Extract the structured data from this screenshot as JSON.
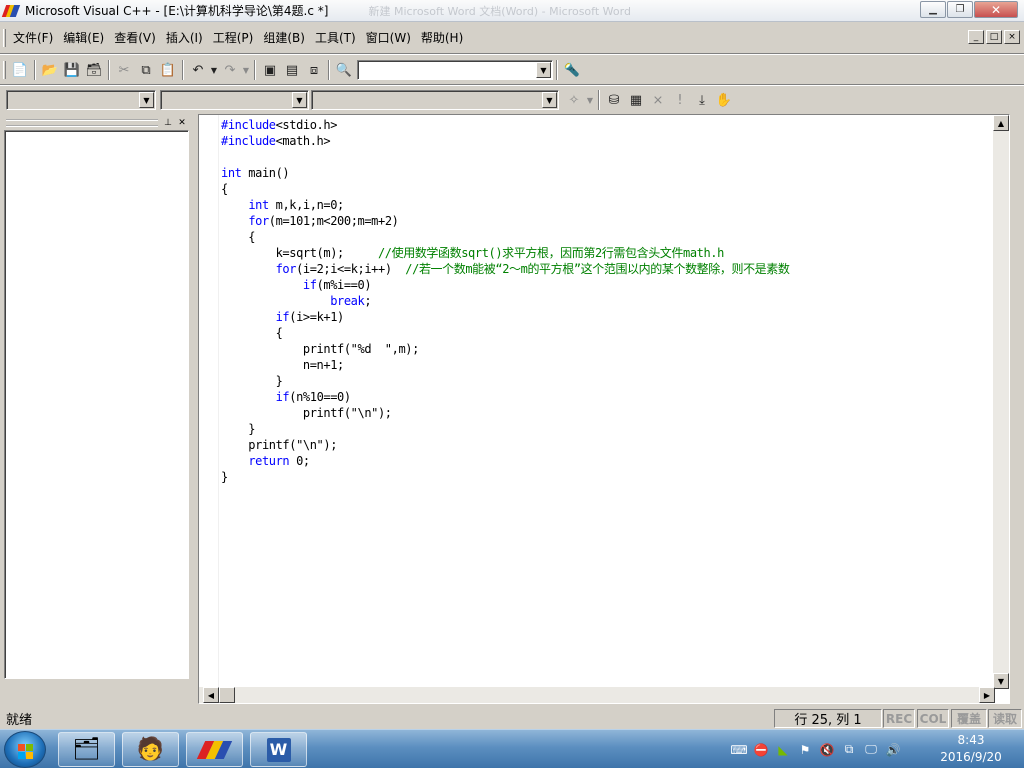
{
  "window": {
    "title": "Microsoft Visual C++ - [E:\\计算机科学导论\\第4题.c *]",
    "background_title": "新建 Microsoft Word 文档(Word) - Microsoft Word"
  },
  "menu": [
    "文件(F)",
    "编辑(E)",
    "查看(V)",
    "插入(I)",
    "工程(P)",
    "组建(B)",
    "工具(T)",
    "窗口(W)",
    "帮助(H)"
  ],
  "mdi_controls": [
    "_",
    "□",
    "×"
  ],
  "toolbar": {
    "icons": [
      "workspace-icon",
      "open-icon",
      "save-icon",
      "save-all-icon",
      "cut-icon",
      "copy-icon",
      "paste-icon",
      "undo-icon",
      "redo-icon",
      "workspace-window-icon",
      "output-window-icon",
      "window-list-icon",
      "find-in-files-icon",
      "find-icon"
    ],
    "find_value": ""
  },
  "wizardbar": {
    "class_value": "",
    "filter_value": "",
    "member_value": ""
  },
  "code": [
    [
      [
        "kw",
        "#include"
      ],
      [
        "t",
        "<stdio.h>"
      ]
    ],
    [
      [
        "kw",
        "#include"
      ],
      [
        "t",
        "<math.h>"
      ]
    ],
    [],
    [
      [
        "kw",
        "int"
      ],
      [
        "t",
        " main()"
      ]
    ],
    [
      [
        "t",
        "{"
      ]
    ],
    [
      [
        "t",
        "    "
      ],
      [
        "kw",
        "int"
      ],
      [
        "t",
        " m,k,i,n=0;"
      ]
    ],
    [
      [
        "t",
        "    "
      ],
      [
        "kw",
        "for"
      ],
      [
        "t",
        "(m=101;m<200;m=m+2)"
      ]
    ],
    [
      [
        "t",
        "    {"
      ]
    ],
    [
      [
        "t",
        "        k=sqrt(m);     "
      ],
      [
        "cm",
        "//使用数学函数sqrt()求平方根，因而第2行需包含头文件math.h"
      ]
    ],
    [
      [
        "t",
        "        "
      ],
      [
        "kw",
        "for"
      ],
      [
        "t",
        "(i=2;i<=k;i++)  "
      ],
      [
        "cm",
        "//若一个数m能被“2～m的平方根”这个范围以内的某个数整除，则不是素数"
      ]
    ],
    [
      [
        "t",
        "            "
      ],
      [
        "kw",
        "if"
      ],
      [
        "t",
        "(m%i==0)"
      ]
    ],
    [
      [
        "t",
        "                "
      ],
      [
        "kw",
        "break"
      ],
      [
        "t",
        ";"
      ]
    ],
    [
      [
        "t",
        "        "
      ],
      [
        "kw",
        "if"
      ],
      [
        "t",
        "(i>=k+1)"
      ]
    ],
    [
      [
        "t",
        "        {"
      ]
    ],
    [
      [
        "t",
        "            printf(\"%d  \",m);"
      ]
    ],
    [
      [
        "t",
        "            n=n+1;"
      ]
    ],
    [
      [
        "t",
        "        }"
      ]
    ],
    [
      [
        "t",
        "        "
      ],
      [
        "kw",
        "if"
      ],
      [
        "t",
        "(n%10==0)"
      ]
    ],
    [
      [
        "t",
        "            printf(\"\\n\");"
      ]
    ],
    [
      [
        "t",
        "    }"
      ]
    ],
    [
      [
        "t",
        "    printf(\"\\n\");"
      ]
    ],
    [
      [
        "t",
        "    "
      ],
      [
        "kw",
        "return"
      ],
      [
        "t",
        " 0;"
      ]
    ],
    [
      [
        "t",
        "}"
      ]
    ]
  ],
  "status": {
    "message": "就绪",
    "position": "行 25, 列 1",
    "rec": "REC",
    "col": "COL",
    "ovr": "覆盖",
    "read": "读取"
  },
  "taskbar": {
    "apps": [
      "explorer",
      "contact",
      "visual-cpp",
      "word"
    ],
    "time": "8:43",
    "date": "2016/9/20"
  },
  "colors": {
    "keyword": "#0000ff",
    "comment": "#008000",
    "face": "#d4d0c8"
  }
}
